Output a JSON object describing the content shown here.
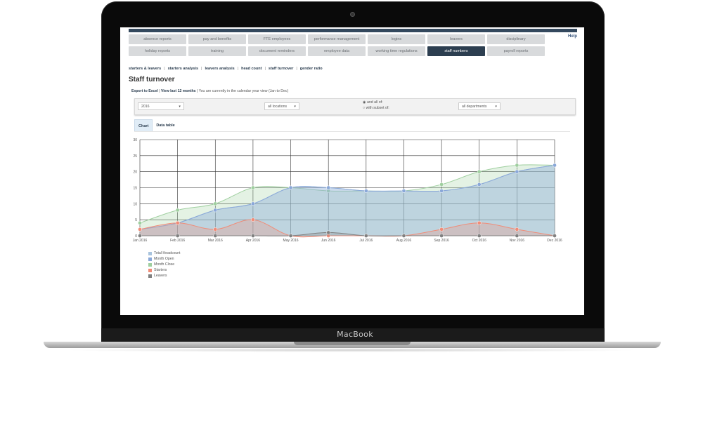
{
  "device": {
    "brand": "MacBook"
  },
  "app": {
    "help_label": "Help",
    "nav_rows": [
      [
        "absence reports",
        "pay and benefits",
        "FTE employees",
        "performance management",
        "logins",
        "leavers",
        "disciplinary"
      ],
      [
        "holiday reports",
        "training",
        "document reminders",
        "employee data",
        "working time regulations",
        "staff numbers",
        "payroll reports"
      ]
    ],
    "active_nav": "staff numbers",
    "sublinks": [
      "starters & leavers",
      "starters analysis",
      "leavers analysis",
      "head count",
      "staff turnover",
      "gender ratio"
    ],
    "page_title": "Staff turnover",
    "export_label": "Export to Excel",
    "view_last_label": "View last 12 months",
    "view_info": "You are currently in the calendar year view (Jan to Dec)",
    "filters": {
      "year": "2016",
      "locations": "all locations",
      "radio_all": "and all of:",
      "radio_subset": "with subset of:",
      "departments": "all departments"
    },
    "tabs": [
      "Chart",
      "Data table"
    ],
    "active_tab": "Chart"
  },
  "chart_data": {
    "type": "area",
    "categories": [
      "Jan 2016",
      "Feb 2016",
      "Mar 2016",
      "Apr 2016",
      "May 2016",
      "Jun 2016",
      "Jul 2016",
      "Aug 2016",
      "Sep 2016",
      "Oct 2016",
      "Nov 2016",
      "Dec 2016"
    ],
    "ylim": [
      0,
      30
    ],
    "yticks": [
      0,
      5,
      10,
      15,
      20,
      25,
      30
    ],
    "grid": true,
    "legend_position": "bottom-left",
    "series": [
      {
        "name": "Total Headcount",
        "color": "#a9c4de",
        "values": [
          2,
          4,
          8,
          10,
          15,
          15,
          14,
          14,
          14,
          16,
          20,
          22
        ]
      },
      {
        "name": "Month Open",
        "color": "#8aa8d8",
        "values": [
          2,
          4,
          8,
          10,
          15,
          15,
          14,
          14,
          14,
          16,
          20,
          22
        ]
      },
      {
        "name": "Month Close",
        "color": "#9fcf9f",
        "values": [
          4,
          8,
          10,
          15,
          15,
          14,
          14,
          14,
          16,
          20,
          22,
          22
        ]
      },
      {
        "name": "Starters",
        "color": "#f08c78",
        "values": [
          2,
          4,
          2,
          5,
          0,
          0,
          0,
          0,
          2,
          4,
          2,
          0
        ]
      },
      {
        "name": "Leavers",
        "color": "#808080",
        "values": [
          0,
          0,
          0,
          0,
          0,
          1,
          0,
          0,
          0,
          0,
          0,
          0
        ]
      }
    ]
  }
}
